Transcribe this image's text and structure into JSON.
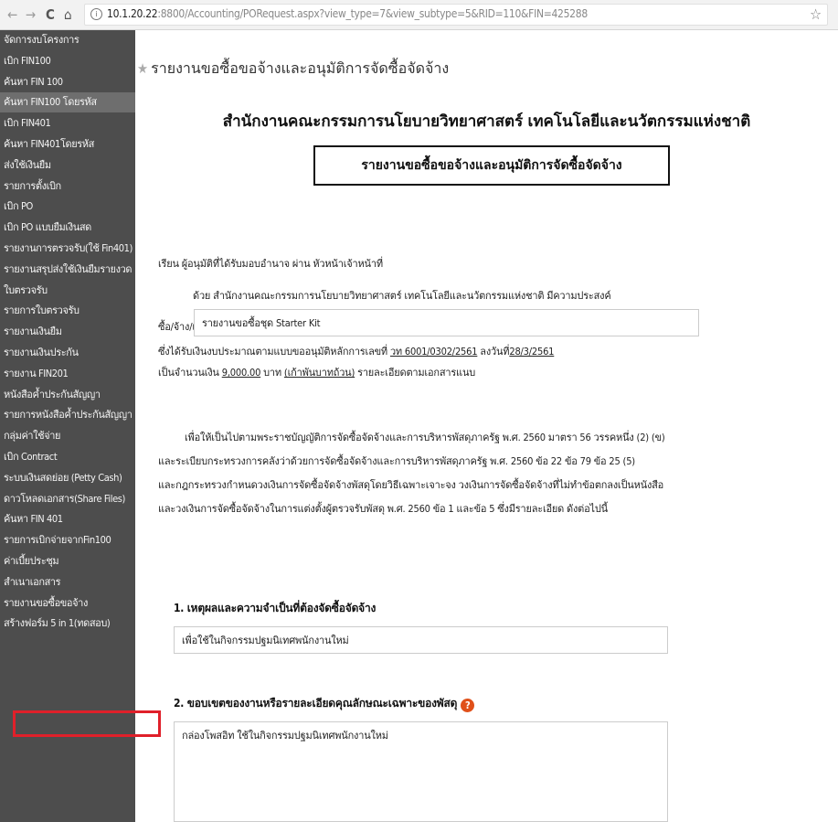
{
  "browser": {
    "back": "←",
    "forward": "→",
    "reload": "C",
    "home": "⌂",
    "info": "i",
    "url_host": "10.1.20.22",
    "url_rest": ":8800/Accounting/PORequest.aspx?view_type=7&view_subtype=5&RID=110&FIN=425288",
    "star": "☆"
  },
  "sidebar": {
    "items": [
      {
        "label": "จัดการงบโครงการ"
      },
      {
        "label": "เบิก FIN100"
      },
      {
        "label": "ค้นหา FIN 100"
      },
      {
        "label": "ค้นหา FIN100 โดยรหัส"
      },
      {
        "label": "เบิก FIN401"
      },
      {
        "label": "ค้นหา FIN401โดยรหัส"
      },
      {
        "label": "ส่งใช้เงินยืม"
      },
      {
        "label": "รายการตั้งเบิก"
      },
      {
        "label": "เบิก PO"
      },
      {
        "label": "เบิก PO แบบยืมเงินสด"
      },
      {
        "label": "รายงานการตรวจรับ(ใช้ Fin401)"
      },
      {
        "label": "รายงานสรุปส่งใช้เงินยืมรายงวด"
      },
      {
        "label": "ใบตรวจรับ"
      },
      {
        "label": "รายการใบตรวจรับ"
      },
      {
        "label": "รายงานเงินยืม"
      },
      {
        "label": "รายงานเงินประกัน"
      },
      {
        "label": "รายงาน FIN201"
      },
      {
        "label": "หนังสือค้ำประกันสัญญา"
      },
      {
        "label": "รายการหนังสือค้ำประกันสัญญา"
      },
      {
        "label": "กลุ่มค่าใช้จ่าย"
      },
      {
        "label": "เบิก Contract"
      },
      {
        "label": "ระบบเงินสดย่อย (Petty Cash)"
      },
      {
        "label": "ดาวโหลดเอกสาร(Share Files)"
      },
      {
        "label": "ค้นหา FIN 401"
      },
      {
        "label": "รายการเบิกจ่ายจากFin100"
      },
      {
        "label": "ค่าเบี้ยประชุม"
      },
      {
        "label": "สำเนาเอกสาร"
      },
      {
        "label": "รายงานขอซื้อขอจ้าง"
      },
      {
        "label": "สร้างฟอร์ม 5 in 1(ทดสอบ)"
      }
    ]
  },
  "main": {
    "title_star": "★",
    "page_title": "รายงานขอซื้อขอจ้างและอนุมัติการจัดซื้อจัดจ้าง",
    "org_title": "สำนักงานคณะกรรมการนโยบายวิทยาศาสตร์ เทคโนโลยีและนวัตกรรมแห่งชาติ",
    "report_box": "รายงานขอซื้อขอจ้างและอนุมัติการจัดซื้อจัดจ้าง",
    "salutation": "เรียน ผู้อนุมัติที่ได้รับมอบอำนาจ ผ่าน หัวหน้าเจ้าหน้าที่",
    "intro": "ด้วย สำนักงานคณะกรรมการนโยบายวิทยาศาสตร์ เทคโนโลยีและนวัตกรรมแห่งชาติ มีความประสงค์",
    "purchase_label": "ซื้อ/จ้าง/เช่า",
    "purchase_value": "รายงานขอซื้อชุด Starter Kit",
    "budget_prefix": "ซึ่งได้รับเงินงบประมาณตามแบบขออนุมัติหลักการเลขที่",
    "budget_doc_no": "วท 6001/0302/2561",
    "budget_date_label": "ลงวันที่",
    "budget_date": "28/3/2561",
    "amount_prefix": "เป็นจำนวนเงิน",
    "amount": "9,000.00",
    "amount_unit": "บาท",
    "amount_text": "(เก้าพันบาทถ้วน)",
    "amount_suffix": "รายละเอียดตามเอกสารแนบ",
    "law_1": "เพื่อให้เป็นไปตามพระราชบัญญัติการจัดซื้อจัดจ้างและการบริหารพัสดุภาครัฐ พ.ศ. 2560 มาตรา 56 วรรคหนึ่ง (2) (ข)",
    "law_2": "และระเบียบกระทรวงการคลังว่าด้วยการจัดซื้อจัดจ้างและการบริหารพัสดุภาครัฐ พ.ศ. 2560 ข้อ 22 ข้อ 79 ข้อ 25 (5)",
    "law_3": "และกฎกระทรวงกำหนดวงเงินการจัดซื้อจัดจ้างพัสดุโดยวิธีเฉพาะเจาะจง วงเงินการจัดซื้อจัดจ้างที่ไม่ทำข้อตกลงเป็นหนังสือ",
    "law_4": "และวงเงินการจัดซื้อจัดจ้างในการแต่งตั้งผู้ตรวจรับพัสดุ พ.ศ. 2560 ข้อ 1 และข้อ 5 ซึ่งมีรายละเอียด ดังต่อไปนี้",
    "section1_heading": "1. เหตุผลและความจำเป็นที่ต้องจัดซื้อจัดจ้าง",
    "section1_value": "เพื่อใช้ในกิจกรรมปฐมนิเทศพนักงานใหม่",
    "section2_heading": "2. ขอบเขตของงานหรือรายละเอียดคุณลักษณะเฉพาะของพัสดุ",
    "help": "?",
    "section2_value": "กล่องโพสอิท ใช้ในกิจกรรมปฐมนิเทศพนักงานใหม่"
  }
}
